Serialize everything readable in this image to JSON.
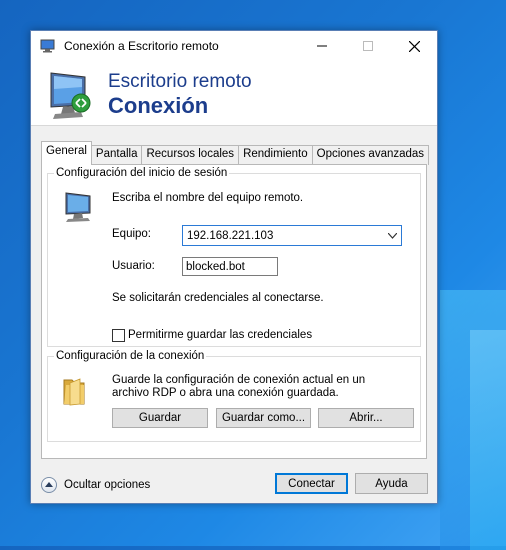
{
  "window": {
    "title": "Conexión a Escritorio remoto",
    "controls": {
      "minimize": "—",
      "maximize": "☐",
      "close": "✕"
    }
  },
  "banner": {
    "line1": "Escritorio remoto",
    "line2": "Conexión"
  },
  "tabs": [
    {
      "label": "General",
      "active": true
    },
    {
      "label": "Pantalla"
    },
    {
      "label": "Recursos locales"
    },
    {
      "label": "Rendimiento"
    },
    {
      "label": "Opciones avanzadas"
    }
  ],
  "logon": {
    "legend": "Configuración del inicio de sesión",
    "instruction": "Escriba el nombre del equipo remoto.",
    "computer_label": "Equipo:",
    "computer_value": "192.168.221.103",
    "user_label": "Usuario:",
    "user_value": "blocked.bot",
    "credentials_note": "Se solicitarán credenciales al conectarse.",
    "allow_save_label": "Permitirme guardar las credenciales",
    "allow_save_checked": false
  },
  "connection": {
    "legend": "Configuración de la conexión",
    "description": "Guarde la configuración de conexión actual en un archivo RDP o abra una conexión guardada.",
    "save_label": "Guardar",
    "save_as_label": "Guardar como...",
    "open_label": "Abrir..."
  },
  "footer": {
    "toggle_label": "Ocultar opciones",
    "connect_label": "Conectar",
    "help_label": "Ayuda"
  },
  "colors": {
    "accent": "#0078d7",
    "banner_text": "#1c3d8c"
  }
}
